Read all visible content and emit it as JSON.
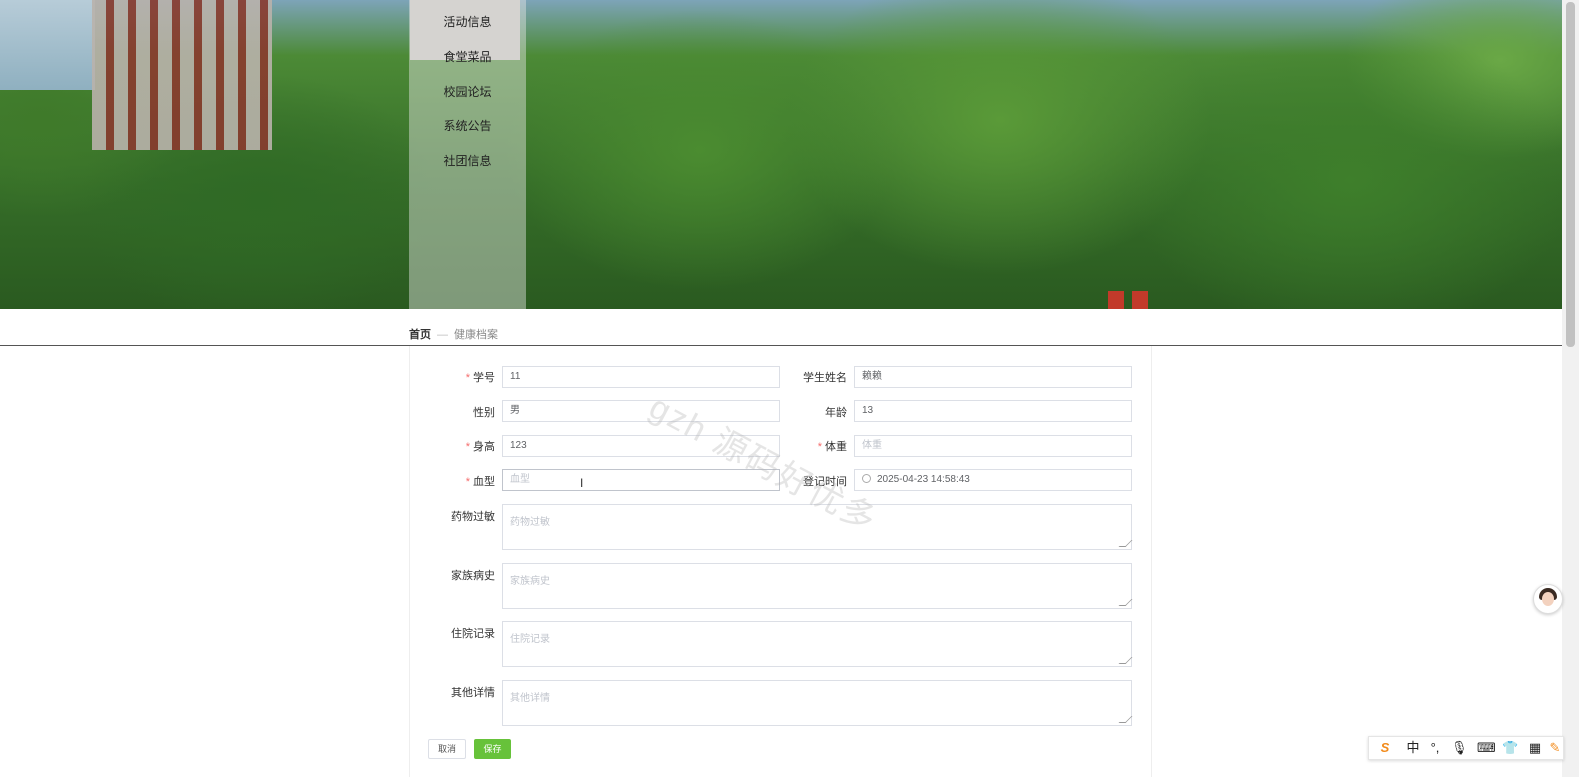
{
  "nav": {
    "items": [
      "活动信息",
      "食堂菜品",
      "校园论坛",
      "系统公告",
      "社团信息"
    ]
  },
  "breadcrumb": {
    "home": "首页",
    "separator": "—",
    "current": "健康档案"
  },
  "form": {
    "student_id": {
      "label": "学号",
      "required": true,
      "value": "11"
    },
    "student_name": {
      "label": "学生姓名",
      "required": false,
      "value": "赖赖"
    },
    "gender": {
      "label": "性别",
      "required": false,
      "value": "男"
    },
    "age": {
      "label": "年龄",
      "required": false,
      "value": "13"
    },
    "height": {
      "label": "身高",
      "required": true,
      "value": "123"
    },
    "weight": {
      "label": "体重",
      "required": true,
      "placeholder": "体重"
    },
    "blood_type": {
      "label": "血型",
      "required": true,
      "placeholder": "血型"
    },
    "register_time": {
      "label": "登记时间",
      "required": false,
      "value": "2025-04-23 14:58:43"
    },
    "drug_allergy": {
      "label": "药物过敏",
      "placeholder": "药物过敏"
    },
    "family_history": {
      "label": "家族病史",
      "placeholder": "家族病史"
    },
    "hospital_record": {
      "label": "住院记录",
      "placeholder": "住院记录"
    },
    "other_details": {
      "label": "其他详情",
      "placeholder": "其他详情"
    },
    "required_mark": "*"
  },
  "buttons": {
    "cancel": "取消",
    "save": "保存"
  },
  "watermark": "gzh 源码好优多",
  "ime": {
    "logo": "S",
    "mode": "中",
    "icons": [
      "punctuation-icon",
      "microphone-icon",
      "keyboard-icon",
      "skin-icon",
      "grid-icon"
    ]
  },
  "colors": {
    "save_button": "#67c23a",
    "required": "#f56c6c"
  }
}
